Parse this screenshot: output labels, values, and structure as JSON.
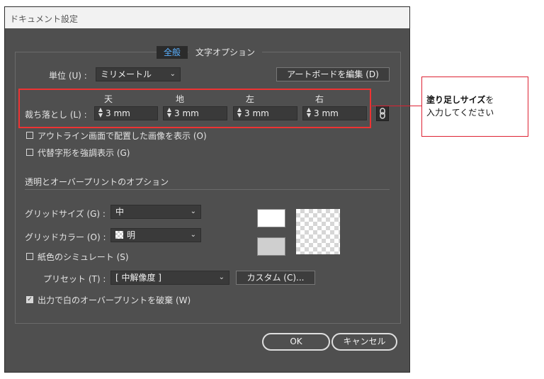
{
  "dialog": {
    "title": "ドキュメント設定",
    "tabs": [
      {
        "label": "全般",
        "active": true
      },
      {
        "label": "文字オプション",
        "active": false
      }
    ],
    "units": {
      "label": "単位 (U) :",
      "value": "ミリメートル"
    },
    "artboard_button": "アートボードを編集 (D)",
    "bleed": {
      "label": "裁ち落とし (L) :",
      "columns": [
        {
          "header": "天",
          "value": "3 mm"
        },
        {
          "header": "地",
          "value": "3 mm"
        },
        {
          "header": "左",
          "value": "3 mm"
        },
        {
          "header": "右",
          "value": "3 mm"
        }
      ],
      "link_icon": "chain-link-icon"
    },
    "options": {
      "show_images_outline": "アウトライン画面で配置した画像を表示 (O)",
      "highlight_substituted_glyphs": "代替字形を強調表示 (G)"
    },
    "transparency": {
      "section_title": "透明とオーバープリントのオプション",
      "grid_size": {
        "label": "グリッドサイズ (G) :",
        "value": "中"
      },
      "grid_color": {
        "label": "グリッドカラー (O) :",
        "value": "明"
      },
      "simulate_paper": "紙色のシミュレート (S)",
      "preset": {
        "label": "プリセット (T) :",
        "value": "[ 中解像度 ]"
      },
      "custom_button": "カスタム (C)...",
      "discard_overprint": "出力で白のオーバープリントを破棄 (W)",
      "discard_overprint_checked": true
    },
    "ok_button": "OK",
    "cancel_button": "キャンセル"
  },
  "callout": {
    "bold_text": "塗り足しサイズ",
    "rest_line1": "を",
    "line2": "入力してください"
  },
  "colors": {
    "dialog_bg": "#4f4f4f",
    "highlight": "#e33333",
    "tab_active_text": "#5ab0ff"
  }
}
